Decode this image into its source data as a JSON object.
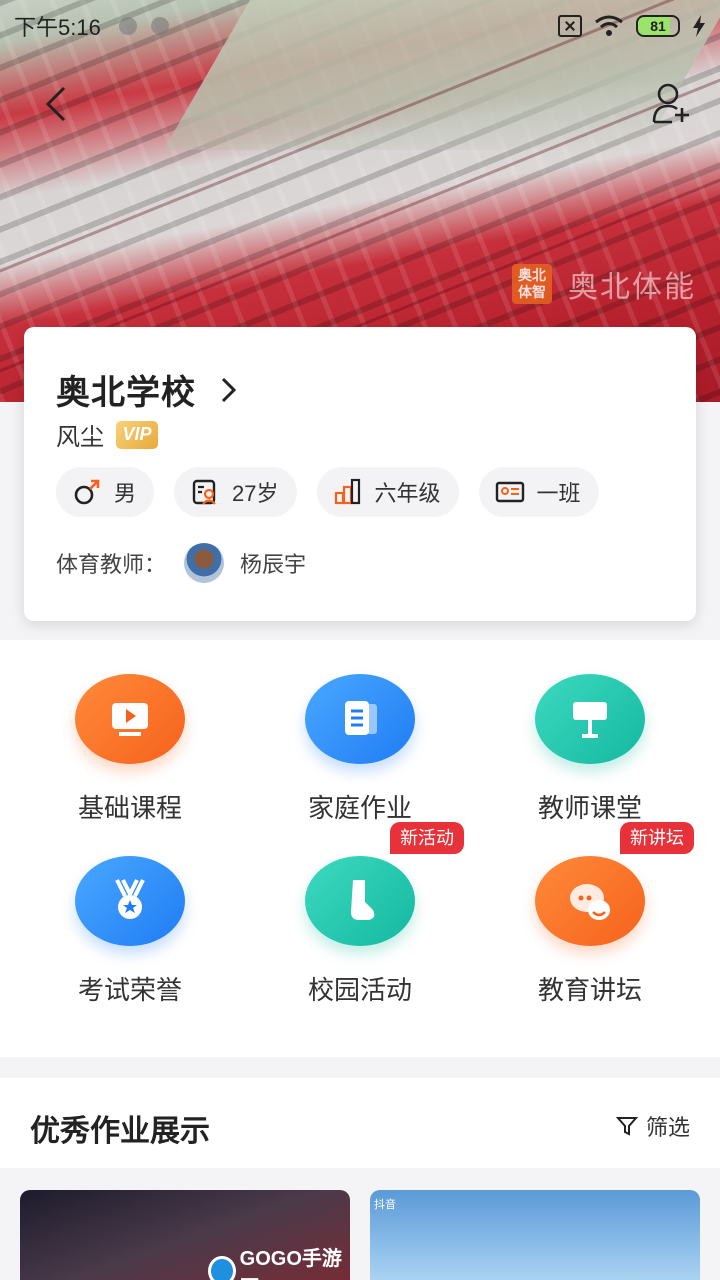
{
  "status_bar": {
    "time": "下午5:16",
    "battery": "81"
  },
  "hero": {
    "brand_logo_text": "奥北体智",
    "brand_name": "奥北体能"
  },
  "profile": {
    "school": "奥北学校",
    "user_name": "风尘",
    "vip_label": "VIP",
    "chips": {
      "gender": "男",
      "age": "27岁",
      "grade": "六年级",
      "class": "一班"
    },
    "teacher_label": "体育教师：",
    "teacher_name": "杨辰宇"
  },
  "menu": [
    {
      "label": "基础课程",
      "icon": "video-icon",
      "color": "#f6621c"
    },
    {
      "label": "家庭作业",
      "icon": "clipboard-icon",
      "color": "#1f7cf4"
    },
    {
      "label": "教师课堂",
      "icon": "lectern-icon",
      "color": "#14b8a0"
    },
    {
      "label": "考试荣誉",
      "icon": "medal-icon",
      "color": "#1f7cf4"
    },
    {
      "label": "校园活动",
      "icon": "sock-icon",
      "color": "#14b8a0",
      "badge": "新活动"
    },
    {
      "label": "教育讲坛",
      "icon": "chat-icon",
      "color": "#f6621c",
      "badge": "新讲坛"
    }
  ],
  "showcase": {
    "title": "优秀作业展示",
    "filter_label": "筛选",
    "thumb_1_watermark": "GOGO手游网",
    "thumb_2_watermark": "抖音"
  }
}
